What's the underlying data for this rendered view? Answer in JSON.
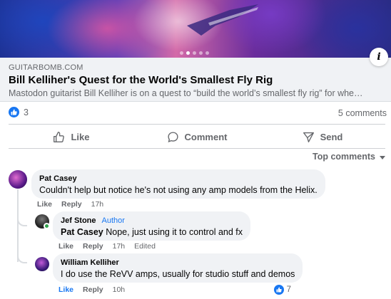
{
  "hero": {
    "dots_total": 5,
    "dot_active": 1
  },
  "link_preview": {
    "domain": "GUITARBOMB.COM",
    "title": "Bill Kelliher's Quest for the World's Smallest Fly Rig",
    "description": "Mastodon guitarist Bill Kelliher is on a quest to “build the world’s smallest fly rig” for when he’s..."
  },
  "reactions": {
    "count": "3",
    "comments_label": "5 comments"
  },
  "actions": {
    "like": "Like",
    "comment": "Comment",
    "send": "Send"
  },
  "sort": {
    "label": "Top comments"
  },
  "comments": [
    {
      "name": "Pat Casey",
      "text": "Couldn't help but notice he's not using any amp models from the Helix.",
      "like_label": "Like",
      "reply_label": "Reply",
      "time": "17h"
    },
    {
      "name": "Jef Stone",
      "badge": "Author",
      "mention": "Pat Casey",
      "text": " Nope, just using it to control and fx",
      "like_label": "Like",
      "reply_label": "Reply",
      "time": "17h",
      "edited": "Edited"
    },
    {
      "name": "William Kelliher",
      "text": "I do use the ReVV amps, usually for studio stuff and demos",
      "like_label": "Like",
      "reply_label": "Reply",
      "time": "10h",
      "reaction_count": "7"
    }
  ],
  "colors": {
    "accent": "#1877f2",
    "secondary_text": "#65676b",
    "bubble": "#f0f2f5",
    "online": "#31a24c"
  }
}
